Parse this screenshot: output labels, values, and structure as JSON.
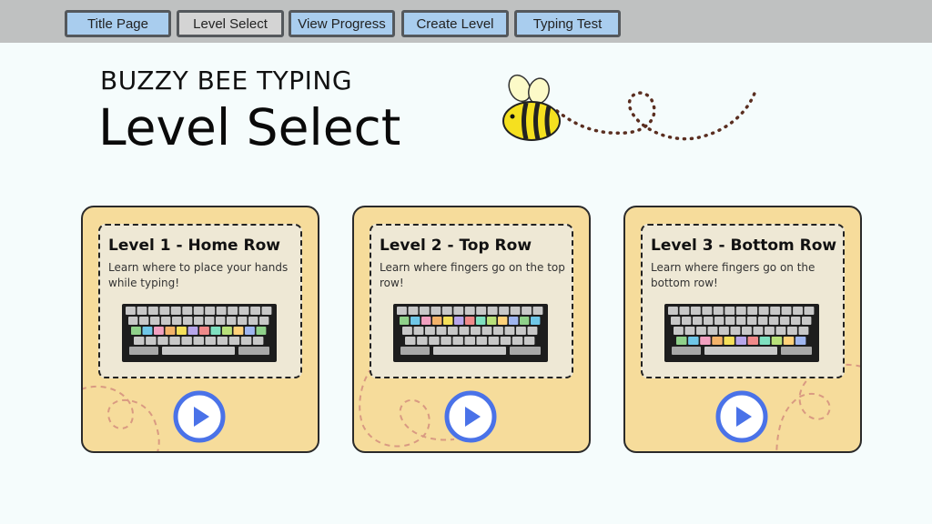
{
  "nav": [
    "Title Page",
    "Level Select",
    "View Progress",
    "Create Level",
    "Typing Test"
  ],
  "brand": "BUZZY BEE TYPING",
  "page_title": "Level Select",
  "levels": [
    {
      "title": "Level 1 - Home Row",
      "desc": "Learn where to place your hands while typing!",
      "highlight_row": "home"
    },
    {
      "title": "Level 2 - Top Row",
      "desc": "Learn where fingers go on the top row!",
      "highlight_row": "top"
    },
    {
      "title": "Level 3 - Bottom Row",
      "desc": "Learn where fingers go on the bottom row!",
      "highlight_row": "bottom"
    }
  ],
  "colors": {
    "nav_button": "#a9cdee",
    "nav_active": "#d4d4d4",
    "card_bg": "#f6dc9b",
    "card_inner": "#eee8d5",
    "play_ring": "#4a72e8",
    "bee_yellow": "#f5e01f"
  }
}
